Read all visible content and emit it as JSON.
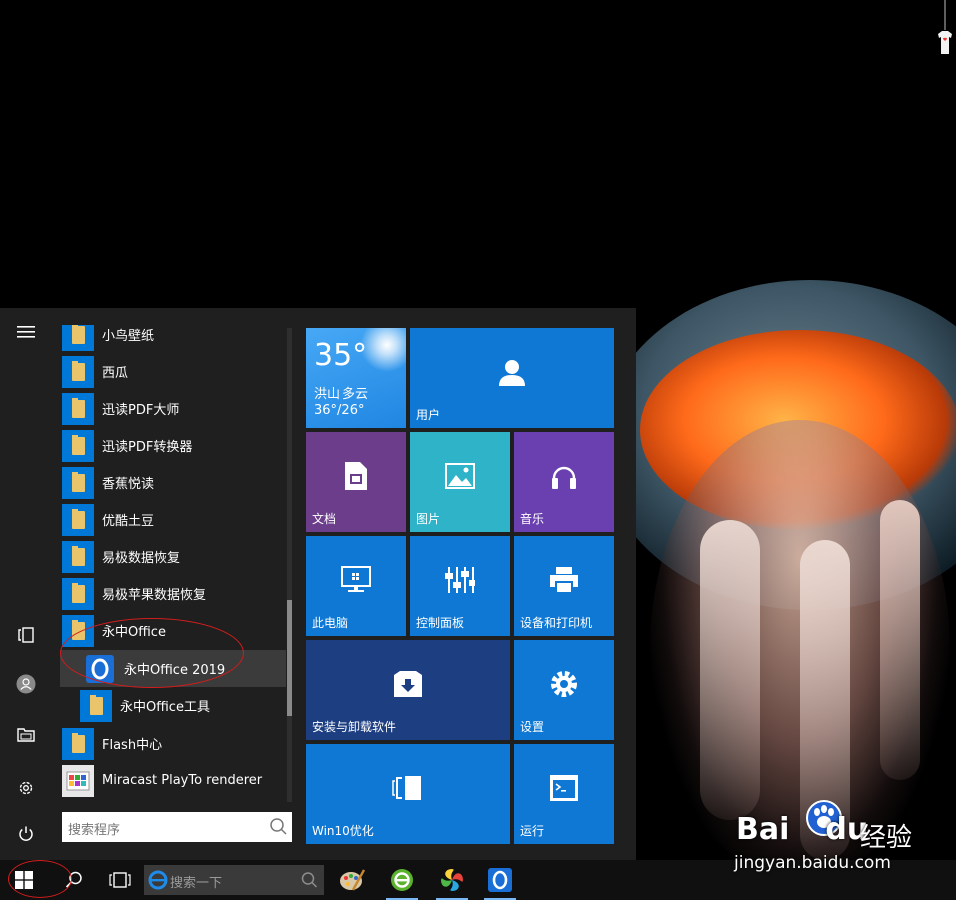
{
  "start_menu": {
    "apps": [
      {
        "label": "小鸟壁纸",
        "type": "folder"
      },
      {
        "label": "西瓜",
        "type": "folder"
      },
      {
        "label": "迅读PDF大师",
        "type": "folder"
      },
      {
        "label": "迅读PDF转换器",
        "type": "folder"
      },
      {
        "label": "香蕉悦读",
        "type": "folder"
      },
      {
        "label": "优酷土豆",
        "type": "folder"
      },
      {
        "label": "易极数据恢复",
        "type": "folder"
      },
      {
        "label": "易极苹果数据恢复",
        "type": "folder"
      },
      {
        "label": "永中Office",
        "type": "folder-open"
      },
      {
        "label": "永中Office 2019",
        "type": "app",
        "selected": true
      },
      {
        "label": "永中Office工具",
        "type": "folder"
      },
      {
        "label": "Flash中心",
        "type": "folder"
      },
      {
        "label": "Miracast PlayTo renderer",
        "type": "app"
      }
    ],
    "search_placeholder": "搜索程序",
    "rail_icons": [
      "hamburger-icon",
      "tablet-mode-icon",
      "user-icon",
      "documents-icon",
      "settings-icon",
      "power-icon"
    ]
  },
  "tiles": {
    "weather": {
      "temp": "35°",
      "city": "洪山",
      "condition": "多云",
      "range": "36°/26°"
    },
    "user": "用户",
    "docs": "文档",
    "pictures": "图片",
    "music": "音乐",
    "pc": "此电脑",
    "control": "控制面板",
    "devices": "设备和打印机",
    "install": "安装与卸载软件",
    "settings": "设置",
    "win10": "Win10优化",
    "run": "运行"
  },
  "taskbar": {
    "search_placeholder": "搜索一下"
  },
  "watermark": {
    "brand_a": "Bai",
    "brand_b": "du",
    "suffix": "经验",
    "url": "jingyan.baidu.com"
  },
  "colors": {
    "tile_blue": "#0e78d4",
    "tile_purple": "#6b3d8a",
    "tile_teal": "#2eb3c9",
    "tile_violet": "#6a3fb0",
    "tile_navy": "#1d3f82",
    "annotation_red": "#d01d1d"
  }
}
